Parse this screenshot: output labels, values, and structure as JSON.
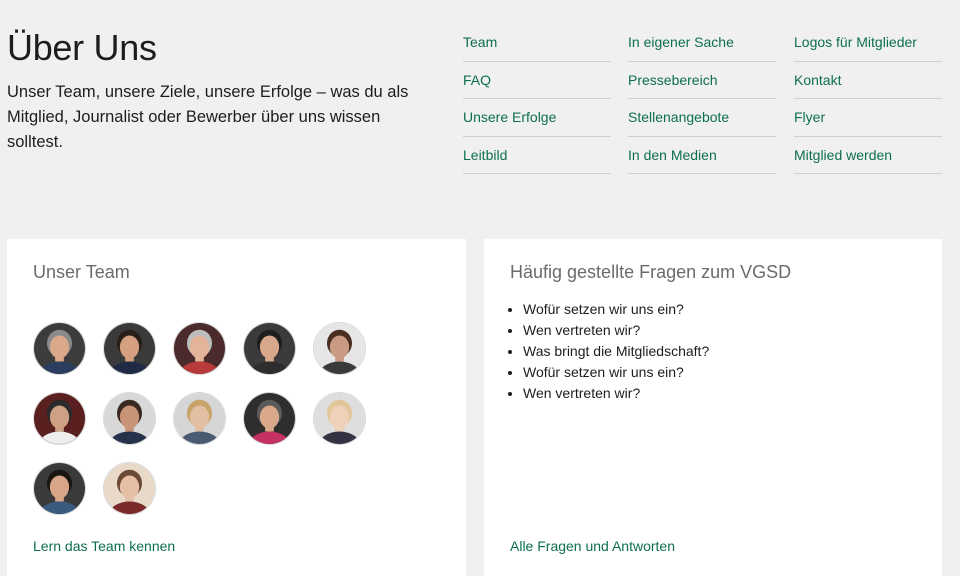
{
  "hero": {
    "title": "Über Uns",
    "subtitle": "Unser Team, unsere Ziele, unsere Erfolge – was du als Mitglied, Journalist oder Bewerber über uns wissen solltest."
  },
  "nav": {
    "col1": [
      "Team",
      "FAQ",
      "Unsere Erfolge",
      "Leitbild"
    ],
    "col2": [
      "In eigener Sache",
      "Pressebereich",
      "Stellenangebote",
      "In den Medien"
    ],
    "col3": [
      "Logos für Mitglieder",
      "Kontakt",
      "Flyer",
      "Mitglied werden"
    ]
  },
  "team": {
    "title": "Unser Team",
    "link": "Lern das Team kennen",
    "avatar_count": 12
  },
  "faq": {
    "title": "Häufig gestellte Fragen zum VGSD",
    "items": [
      "Wofür setzen wir uns ein?",
      "Wen vertreten wir?",
      "Was bringt die Mitgliedschaft?",
      "Wofür setzen wir uns ein?",
      "Wen vertreten wir?"
    ],
    "link": "Alle Fragen und Antworten"
  },
  "colors": {
    "background": "#f0f0ef",
    "link": "#0d6f4f",
    "card": "#ffffff",
    "card_title": "#6b6b6b"
  }
}
